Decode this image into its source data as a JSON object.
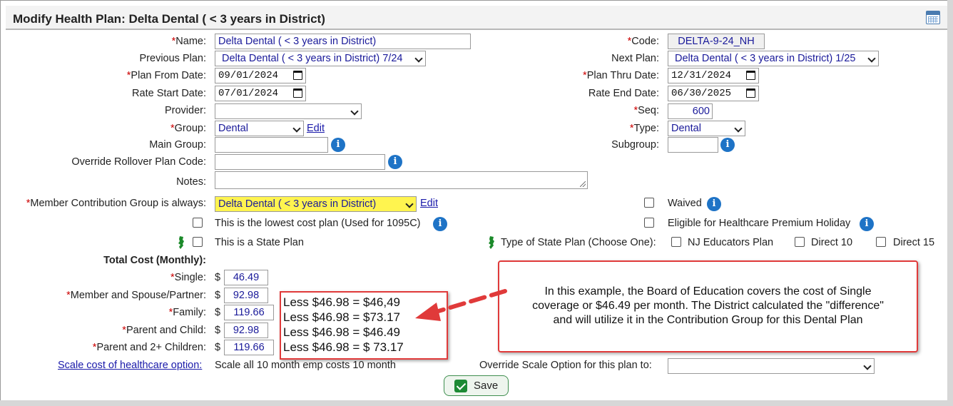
{
  "title": "Modify Health Plan: Delta Dental ( < 3 years in District)",
  "icons": {
    "calendar": "calendar-icon",
    "info": "info-icon",
    "state": "new-jersey-icon"
  },
  "colors": {
    "required": "#cc0000",
    "accent": "#1e73c6",
    "annotation": "#e03a3a",
    "highlight": "#fff44f"
  },
  "left": {
    "name_label": "Name:",
    "name_value": "Delta Dental ( < 3 years in District)",
    "previous_plan_label": "Previous Plan:",
    "previous_plan_value": "Delta Dental ( < 3 years in District) 7/24",
    "plan_from_label": "Plan From Date:",
    "plan_from_value": "09/01/2024",
    "rate_start_label": "Rate Start Date:",
    "rate_start_value": "07/01/2024",
    "provider_label": "Provider:",
    "provider_value": "",
    "group_label": "Group:",
    "group_value": "Dental",
    "group_edit": "Edit",
    "main_group_label": "Main Group:",
    "override_rollover_label": "Override Rollover Plan Code:",
    "notes_label": "Notes:",
    "member_contrib_label": "Member Contribution Group is always:",
    "member_contrib_value": "Delta Dental ( < 3 years in District)",
    "member_contrib_edit": "Edit",
    "lowest_cost_label": "This is the lowest cost plan (Used for 1095C)",
    "state_plan_label": "This is a State Plan"
  },
  "right": {
    "code_label": "Code:",
    "code_value": "DELTA-9-24_NH",
    "next_plan_label": "Next Plan:",
    "next_plan_value": "Delta Dental ( < 3 years in District) 1/25",
    "plan_thru_label": "Plan Thru Date:",
    "plan_thru_value": "12/31/2024",
    "rate_end_label": "Rate End Date:",
    "rate_end_value": "06/30/2025",
    "seq_label": "Seq:",
    "seq_value": "600",
    "type_label": "Type:",
    "type_value": "Dental",
    "subgroup_label": "Subgroup:",
    "waived_label": "Waived",
    "premium_holiday_label": "Eligible for Healthcare Premium Holiday",
    "state_type_label": "Type of State Plan (Choose One):",
    "state_options": [
      "NJ Educators Plan",
      "Direct 10",
      "Direct 15"
    ]
  },
  "costs": {
    "heading": "Total Cost (Monthly):",
    "currency": "$",
    "rows": [
      {
        "label": "Single:",
        "value": "46.49"
      },
      {
        "label": "Member and Spouse/Partner:",
        "value": "92.98"
      },
      {
        "label": "Family:",
        "value": "119.66"
      },
      {
        "label": "Parent and Child:",
        "value": "92.98"
      },
      {
        "label": "Parent and 2+ Children:",
        "value": "119.66"
      }
    ]
  },
  "scale": {
    "link": "Scale cost of healthcare option:",
    "value": "Scale all 10 month emp costs 10 month",
    "override_label": "Override Scale Option for this plan to:",
    "override_value": ""
  },
  "annotation": {
    "lines": [
      "Less $46.98 = $46,49",
      "Less $46.98 = $73.17",
      "Less $46.98 = $46.49",
      "Less $46.98 = $ 73.17"
    ],
    "callout": [
      "In this example, the Board of Education covers the cost of Single",
      "coverage or $46.49 per month.  The District calculated the \"difference\"",
      "and will utilize it in the Contribution Group for this Dental Plan"
    ]
  },
  "save_label": "Save"
}
